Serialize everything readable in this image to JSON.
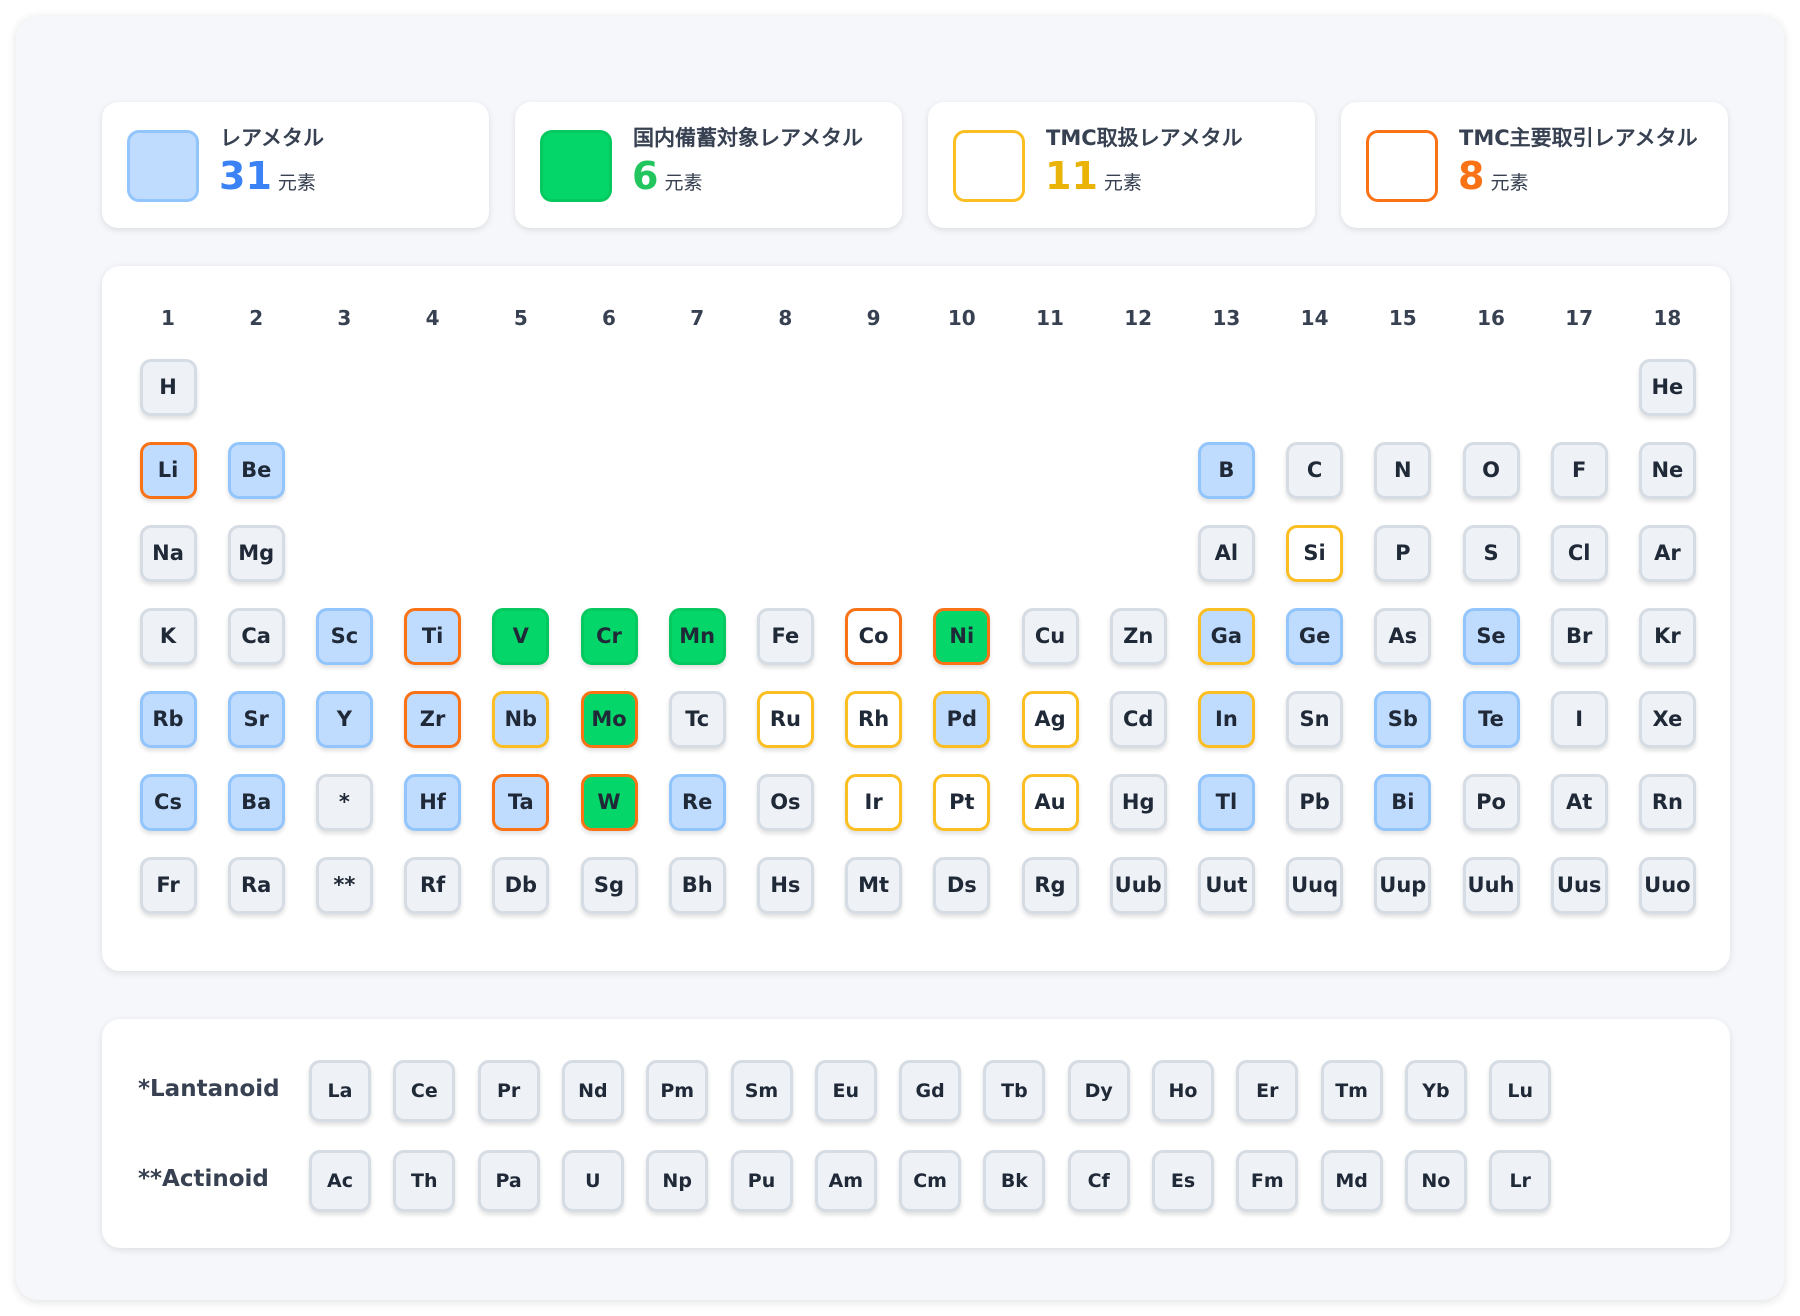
{
  "legend": [
    {
      "label": "レアメタル",
      "count": "31",
      "unit": "元素",
      "color": "#3b82f6",
      "swatch_fill": "#bfdbfe",
      "swatch_border": "#93c5fd"
    },
    {
      "label": "国内備蓄対象レアメタル",
      "count": "6",
      "unit": "元素",
      "color": "#22c55e",
      "swatch_fill": "#05d669",
      "swatch_border": "#05c95f"
    },
    {
      "label": "TMC取扱レアメタル",
      "count": "11",
      "unit": "元素",
      "color": "#eab308",
      "swatch_fill": "#ffffff",
      "swatch_border": "#fbbf24"
    },
    {
      "label": "TMC主要取引レアメタル",
      "count": "8",
      "unit": "元素",
      "color": "#f97316",
      "swatch_fill": "#ffffff",
      "swatch_border": "#f97316"
    }
  ],
  "groups": [
    "1",
    "2",
    "3",
    "4",
    "5",
    "6",
    "7",
    "8",
    "9",
    "10",
    "11",
    "12",
    "13",
    "14",
    "15",
    "16",
    "17",
    "18"
  ],
  "periods": [
    [
      {
        "g": 1,
        "s": "H"
      },
      {
        "g": 18,
        "s": "He"
      }
    ],
    [
      {
        "g": 1,
        "s": "Li",
        "c": [
          "rare",
          "major"
        ]
      },
      {
        "g": 2,
        "s": "Be",
        "c": [
          "rare"
        ]
      },
      {
        "g": 13,
        "s": "B",
        "c": [
          "rare"
        ]
      },
      {
        "g": 14,
        "s": "C"
      },
      {
        "g": 15,
        "s": "N"
      },
      {
        "g": 16,
        "s": "O"
      },
      {
        "g": 17,
        "s": "F"
      },
      {
        "g": 18,
        "s": "Ne"
      }
    ],
    [
      {
        "g": 1,
        "s": "Na"
      },
      {
        "g": 2,
        "s": "Mg"
      },
      {
        "g": 13,
        "s": "Al"
      },
      {
        "g": 14,
        "s": "Si",
        "c": [
          "tmc"
        ]
      },
      {
        "g": 15,
        "s": "P"
      },
      {
        "g": 16,
        "s": "S"
      },
      {
        "g": 17,
        "s": "Cl"
      },
      {
        "g": 18,
        "s": "Ar"
      }
    ],
    [
      {
        "g": 1,
        "s": "K"
      },
      {
        "g": 2,
        "s": "Ca"
      },
      {
        "g": 3,
        "s": "Sc",
        "c": [
          "rare"
        ]
      },
      {
        "g": 4,
        "s": "Ti",
        "c": [
          "rare",
          "major"
        ]
      },
      {
        "g": 5,
        "s": "V",
        "c": [
          "stock"
        ]
      },
      {
        "g": 6,
        "s": "Cr",
        "c": [
          "stock"
        ]
      },
      {
        "g": 7,
        "s": "Mn",
        "c": [
          "stock"
        ]
      },
      {
        "g": 8,
        "s": "Fe"
      },
      {
        "g": 9,
        "s": "Co",
        "c": [
          "major"
        ]
      },
      {
        "g": 10,
        "s": "Ni",
        "c": [
          "stock",
          "major"
        ]
      },
      {
        "g": 11,
        "s": "Cu"
      },
      {
        "g": 12,
        "s": "Zn"
      },
      {
        "g": 13,
        "s": "Ga",
        "c": [
          "rare",
          "tmc"
        ]
      },
      {
        "g": 14,
        "s": "Ge",
        "c": [
          "rare"
        ]
      },
      {
        "g": 15,
        "s": "As"
      },
      {
        "g": 16,
        "s": "Se",
        "c": [
          "rare"
        ]
      },
      {
        "g": 17,
        "s": "Br"
      },
      {
        "g": 18,
        "s": "Kr"
      }
    ],
    [
      {
        "g": 1,
        "s": "Rb",
        "c": [
          "rare"
        ]
      },
      {
        "g": 2,
        "s": "Sr",
        "c": [
          "rare"
        ]
      },
      {
        "g": 3,
        "s": "Y",
        "c": [
          "rare"
        ]
      },
      {
        "g": 4,
        "s": "Zr",
        "c": [
          "rare",
          "major"
        ]
      },
      {
        "g": 5,
        "s": "Nb",
        "c": [
          "rare",
          "tmc"
        ]
      },
      {
        "g": 6,
        "s": "Mo",
        "c": [
          "stock",
          "major"
        ]
      },
      {
        "g": 7,
        "s": "Tc"
      },
      {
        "g": 8,
        "s": "Ru",
        "c": [
          "tmc"
        ]
      },
      {
        "g": 9,
        "s": "Rh",
        "c": [
          "tmc"
        ]
      },
      {
        "g": 10,
        "s": "Pd",
        "c": [
          "rare",
          "tmc"
        ]
      },
      {
        "g": 11,
        "s": "Ag",
        "c": [
          "tmc"
        ]
      },
      {
        "g": 12,
        "s": "Cd"
      },
      {
        "g": 13,
        "s": "In",
        "c": [
          "rare",
          "tmc"
        ]
      },
      {
        "g": 14,
        "s": "Sn"
      },
      {
        "g": 15,
        "s": "Sb",
        "c": [
          "rare"
        ]
      },
      {
        "g": 16,
        "s": "Te",
        "c": [
          "rare"
        ]
      },
      {
        "g": 17,
        "s": "I"
      },
      {
        "g": 18,
        "s": "Xe"
      }
    ],
    [
      {
        "g": 1,
        "s": "Cs",
        "c": [
          "rare"
        ]
      },
      {
        "g": 2,
        "s": "Ba",
        "c": [
          "rare"
        ]
      },
      {
        "g": 3,
        "s": "*"
      },
      {
        "g": 4,
        "s": "Hf",
        "c": [
          "rare"
        ]
      },
      {
        "g": 5,
        "s": "Ta",
        "c": [
          "rare",
          "major"
        ]
      },
      {
        "g": 6,
        "s": "W",
        "c": [
          "stock",
          "major"
        ]
      },
      {
        "g": 7,
        "s": "Re",
        "c": [
          "rare"
        ]
      },
      {
        "g": 8,
        "s": "Os"
      },
      {
        "g": 9,
        "s": "Ir",
        "c": [
          "tmc"
        ]
      },
      {
        "g": 10,
        "s": "Pt",
        "c": [
          "tmc"
        ]
      },
      {
        "g": 11,
        "s": "Au",
        "c": [
          "tmc"
        ]
      },
      {
        "g": 12,
        "s": "Hg"
      },
      {
        "g": 13,
        "s": "Tl",
        "c": [
          "rare"
        ]
      },
      {
        "g": 14,
        "s": "Pb"
      },
      {
        "g": 15,
        "s": "Bi",
        "c": [
          "rare"
        ]
      },
      {
        "g": 16,
        "s": "Po"
      },
      {
        "g": 17,
        "s": "At"
      },
      {
        "g": 18,
        "s": "Rn"
      }
    ],
    [
      {
        "g": 1,
        "s": "Fr"
      },
      {
        "g": 2,
        "s": "Ra"
      },
      {
        "g": 3,
        "s": "**"
      },
      {
        "g": 4,
        "s": "Rf"
      },
      {
        "g": 5,
        "s": "Db"
      },
      {
        "g": 6,
        "s": "Sg"
      },
      {
        "g": 7,
        "s": "Bh"
      },
      {
        "g": 8,
        "s": "Hs"
      },
      {
        "g": 9,
        "s": "Mt"
      },
      {
        "g": 10,
        "s": "Ds"
      },
      {
        "g": 11,
        "s": "Rg"
      },
      {
        "g": 12,
        "s": "Uub"
      },
      {
        "g": 13,
        "s": "Uut"
      },
      {
        "g": 14,
        "s": "Uuq"
      },
      {
        "g": 15,
        "s": "Uup"
      },
      {
        "g": 16,
        "s": "Uuh"
      },
      {
        "g": 17,
        "s": "Uus"
      },
      {
        "g": 18,
        "s": "Uuo"
      }
    ]
  ],
  "series": [
    {
      "label": "*Lantanoid",
      "elements": [
        "La",
        "Ce",
        "Pr",
        "Nd",
        "Pm",
        "Sm",
        "Eu",
        "Gd",
        "Tb",
        "Dy",
        "Ho",
        "Er",
        "Tm",
        "Yb",
        "Lu"
      ]
    },
    {
      "label": "**Actinoid",
      "elements": [
        "Ac",
        "Th",
        "Pa",
        "U",
        "Np",
        "Pu",
        "Am",
        "Cm",
        "Bk",
        "Cf",
        "Es",
        "Fm",
        "Md",
        "No",
        "Lr"
      ]
    }
  ]
}
